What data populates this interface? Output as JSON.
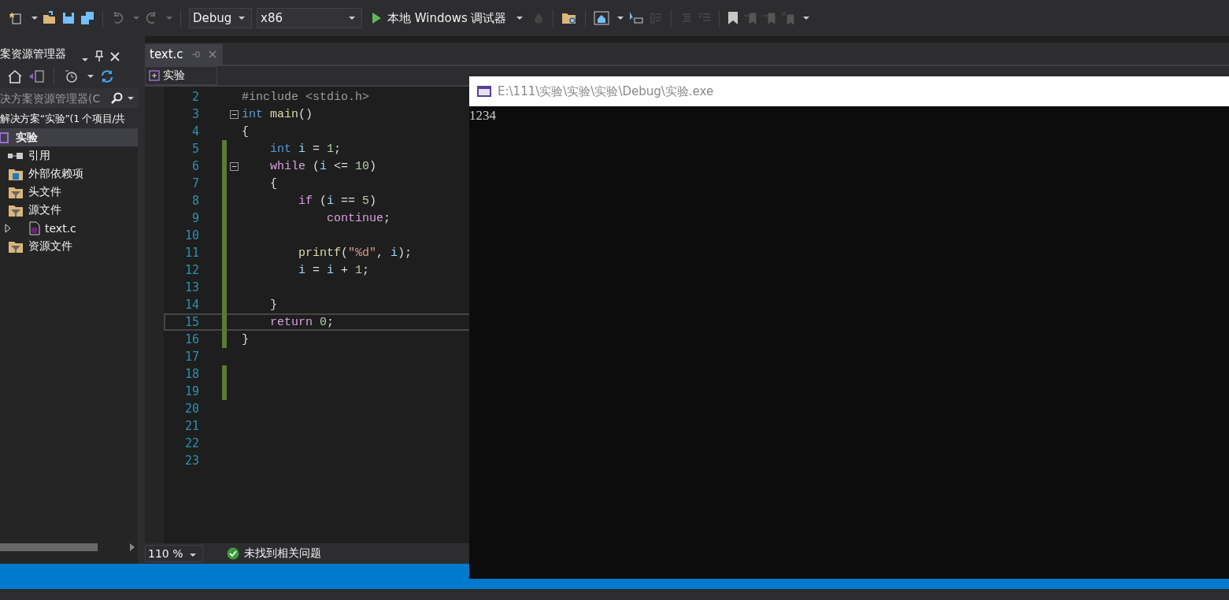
{
  "toolbar": {
    "configuration": "Debug",
    "platform": "x86",
    "run_button": "本地 Windows 调试器"
  },
  "solution_explorer": {
    "title": "案资源管理器",
    "search": {
      "placeholder": "决方案资源管理器(C"
    },
    "solution": "解决方案“实验”(1 个项目/共",
    "tree": [
      {
        "label": "实验",
        "kind": "project",
        "selected": true,
        "children": [
          {
            "label": "引用",
            "kind": "reference",
            "selected": false
          },
          {
            "label": "外部依赖项",
            "kind": "external",
            "selected": false
          },
          {
            "label": "头文件",
            "kind": "filter",
            "selected": false
          },
          {
            "label": "源文件",
            "kind": "filter",
            "selected": false,
            "children": [
              {
                "label": "text.c",
                "kind": "cfile",
                "selected": false,
                "expanded": false
              }
            ]
          },
          {
            "label": "资源文件",
            "kind": "filter",
            "selected": false
          }
        ]
      }
    ]
  },
  "editor": {
    "tabs": [
      {
        "label": "text.c",
        "selected": true
      }
    ],
    "nav_scope": "实验",
    "zoom": "110 %",
    "status": "未找到相关问题",
    "lines": [
      {
        "number": "2",
        "changed": false,
        "fold": false,
        "tokens": [
          {
            "text": "#include <stdio.h>",
            "kind": "preproc"
          }
        ]
      },
      {
        "number": "3",
        "changed": false,
        "fold": true,
        "tokens": [
          {
            "text": "int",
            "kind": "keyword"
          },
          {
            "text": " main",
            "kind": "func"
          },
          {
            "text": "()",
            "kind": "plain"
          }
        ]
      },
      {
        "number": "4",
        "changed": false,
        "fold": false,
        "tokens": [
          {
            "text": "{",
            "kind": "plain"
          }
        ]
      },
      {
        "number": "5",
        "changed": true,
        "fold": false,
        "tokens": [
          {
            "text": "    int",
            "kind": "keyword"
          },
          {
            "text": " i",
            "kind": "var"
          },
          {
            "text": " = ",
            "kind": "plain"
          },
          {
            "text": "1",
            "kind": "number"
          },
          {
            "text": ";",
            "kind": "plain"
          }
        ]
      },
      {
        "number": "6",
        "changed": true,
        "fold": true,
        "tokens": [
          {
            "text": "    while",
            "kind": "control"
          },
          {
            "text": " (",
            "kind": "plain"
          },
          {
            "text": "i",
            "kind": "var"
          },
          {
            "text": " <= ",
            "kind": "plain"
          },
          {
            "text": "10",
            "kind": "number"
          },
          {
            "text": ")",
            "kind": "plain"
          }
        ]
      },
      {
        "number": "7",
        "changed": true,
        "fold": false,
        "tokens": [
          {
            "text": "    {",
            "kind": "plain"
          }
        ]
      },
      {
        "number": "8",
        "changed": true,
        "fold": false,
        "tokens": [
          {
            "text": "        if",
            "kind": "control"
          },
          {
            "text": " (",
            "kind": "plain"
          },
          {
            "text": "i",
            "kind": "var"
          },
          {
            "text": " == ",
            "kind": "plain"
          },
          {
            "text": "5",
            "kind": "number"
          },
          {
            "text": ")",
            "kind": "plain"
          }
        ]
      },
      {
        "number": "9",
        "changed": true,
        "fold": false,
        "tokens": [
          {
            "text": "            continue",
            "kind": "control"
          },
          {
            "text": ";",
            "kind": "plain"
          }
        ]
      },
      {
        "number": "10",
        "changed": true,
        "fold": false
      },
      {
        "number": "11",
        "changed": true,
        "fold": false,
        "tokens": [
          {
            "text": "        printf",
            "kind": "func"
          },
          {
            "text": "(",
            "kind": "plain"
          },
          {
            "text": "\"%d\"",
            "kind": "string"
          },
          {
            "text": ", ",
            "kind": "plain"
          },
          {
            "text": "i",
            "kind": "var"
          },
          {
            "text": ");",
            "kind": "plain"
          }
        ]
      },
      {
        "number": "12",
        "changed": true,
        "fold": false,
        "tokens": [
          {
            "text": "        i",
            "kind": "var"
          },
          {
            "text": " = ",
            "kind": "plain"
          },
          {
            "text": "i",
            "kind": "var"
          },
          {
            "text": " + ",
            "kind": "plain"
          },
          {
            "text": "1",
            "kind": "number"
          },
          {
            "text": ";",
            "kind": "plain"
          }
        ]
      },
      {
        "number": "13",
        "changed": true,
        "fold": false
      },
      {
        "number": "14",
        "changed": true,
        "fold": false,
        "tokens": [
          {
            "text": "    }",
            "kind": "plain"
          }
        ]
      },
      {
        "number": "15",
        "changed": true,
        "fold": false,
        "tokens": [
          {
            "text": "    return",
            "kind": "control"
          },
          {
            "text": " 0",
            "kind": "number"
          },
          {
            "text": ";",
            "kind": "plain"
          }
        ]
      },
      {
        "number": "16",
        "changed": true,
        "fold": false,
        "tokens": [
          {
            "text": "}",
            "kind": "plain"
          }
        ]
      },
      {
        "number": "17",
        "changed": false,
        "fold": false
      },
      {
        "number": "18",
        "changed": true,
        "fold": false
      },
      {
        "number": "19",
        "changed": true,
        "fold": false
      },
      {
        "number": "20",
        "changed": false,
        "fold": false
      },
      {
        "number": "21",
        "changed": false,
        "fold": false
      },
      {
        "number": "22",
        "changed": false,
        "fold": false
      },
      {
        "number": "23",
        "changed": false,
        "fold": false
      }
    ]
  },
  "console": {
    "title": "E:\\111\\实验\\实验\\实验\\Debug\\实验.exe",
    "output": "1234"
  }
}
